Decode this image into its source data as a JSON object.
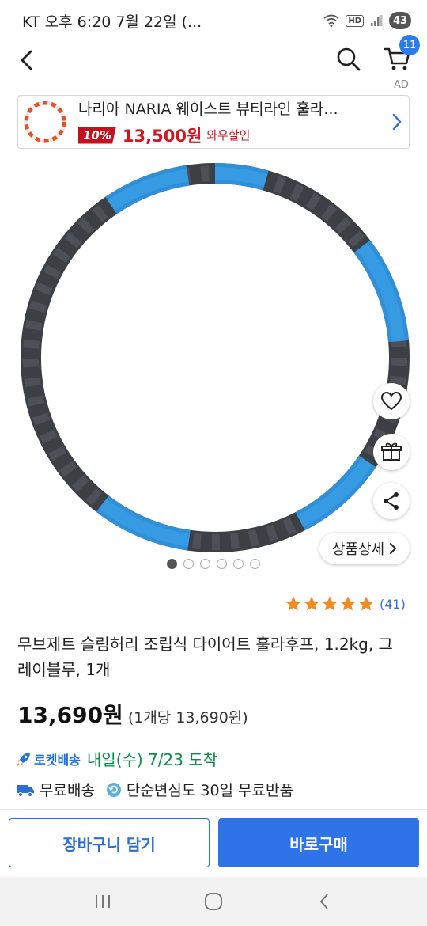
{
  "status_bar": {
    "left_text": "KT 오후 6:20  7월 22일 (...",
    "hd_label": "HD",
    "battery": "43"
  },
  "nav": {
    "cart_count": "11",
    "ad_label": "AD"
  },
  "ad": {
    "title": "나리아 NARIA 웨이스트 뷰티라인 훌라...",
    "discount": "10%",
    "price": "13,500원",
    "sale_label": "와우할인"
  },
  "gallery": {
    "dots": 6,
    "active_index": 0,
    "detail_label": "상품상세"
  },
  "rating": {
    "stars": 5,
    "count": "(41)"
  },
  "product": {
    "title": "무브제트 슬림허리 조립식 다이어트 훌라후프, 1.2kg, 그레이블루, 1개",
    "price": "13,690원",
    "unit_price": "(1개당 13,690원)"
  },
  "delivery": {
    "rocket_label": "로켓배송",
    "arrival": "내일(수) 7/23 도착",
    "free_shipping": "무료배송",
    "return_policy": "단순변심도 30일 무료반품"
  },
  "actions": {
    "add_to_cart": "장바구니 담기",
    "buy_now": "바로구매"
  },
  "colors": {
    "accent": "#2f73e8",
    "price_red": "#d4141e",
    "delivery_green": "#0a8c4b",
    "hoop_blue": "#2f8fd8",
    "hoop_gray": "#3c3f44",
    "star": "#f28b20"
  },
  "icons": [
    "back-icon",
    "search-icon",
    "cart-icon",
    "heart-icon",
    "gift-icon",
    "share-icon",
    "chevron-right-icon",
    "rocket-icon",
    "truck-icon",
    "return-icon",
    "recents-icon",
    "home-icon",
    "system-back-icon"
  ]
}
